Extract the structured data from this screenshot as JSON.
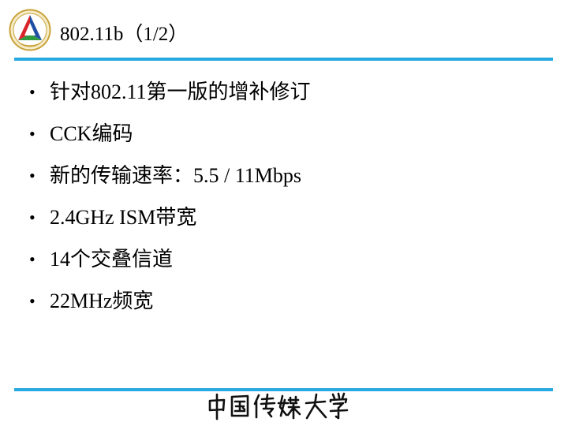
{
  "slide": {
    "title": "802.11b（1/2）",
    "bullets": [
      "针对802.11第一版的增补修订",
      "CCK编码",
      "新的传输速率：5.5 / 11Mbps",
      "2.4GHz ISM带宽",
      "14个交叠信道",
      "22MHz频宽"
    ]
  },
  "footer": {
    "calligraphy": "中国传媒大学"
  },
  "colors": {
    "rule": "#29a9e1",
    "logo_ring": "#c8a23a",
    "logo_red": "#d8232a",
    "logo_blue": "#1e4fa3",
    "logo_green": "#2d9a3f"
  },
  "icons": {
    "logo": "university-emblem-icon",
    "bullet": "bullet-dot-icon"
  }
}
